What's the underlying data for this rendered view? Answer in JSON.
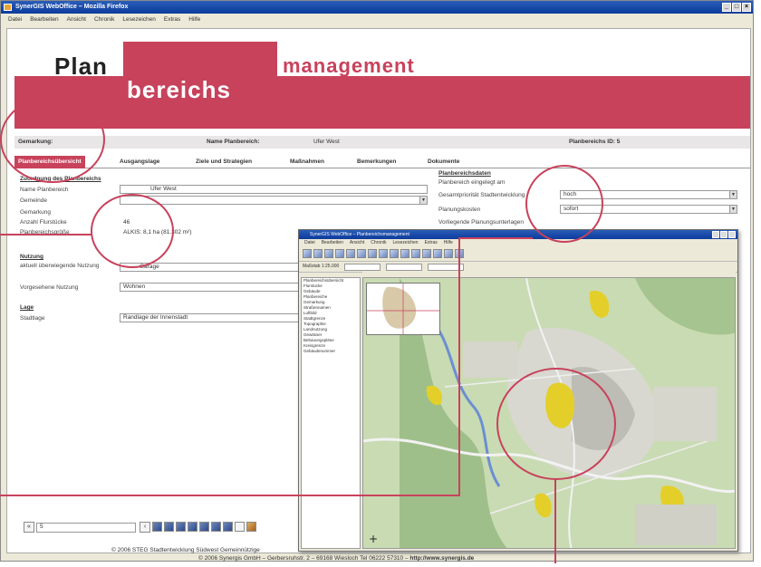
{
  "window": {
    "title": "SynerGIS WebOffice – Mozilla Firefox"
  },
  "menubar": [
    "Datei",
    "Bearbeiten",
    "Ansicht",
    "Chronik",
    "Lesezeichen",
    "Extras",
    "Hilfe"
  ],
  "banner": {
    "plan": "Plan",
    "bereichs": "bereichs",
    "management": "management"
  },
  "infobar": {
    "gemarkung_label": "Gemarkung:",
    "name_label": "Name Planbereich:",
    "name_value": "Ufer West",
    "id_label": "Planbereichs ID: 5"
  },
  "tabs": [
    {
      "label": "Planbereichsübersicht",
      "active": true
    },
    {
      "label": "Ausgangslage",
      "active": false
    },
    {
      "label": "Ziele und Strategien",
      "active": false
    },
    {
      "label": "Maßnahmen",
      "active": false
    },
    {
      "label": "Bemerkungen",
      "active": false
    },
    {
      "label": "Dokumente",
      "active": false
    }
  ],
  "zuordnung": {
    "title": "Zuordnung des Planbereichs",
    "name_label": "Name Planbereich",
    "name_value": "Ufer West",
    "gemeinde_label": "Gemeinde",
    "gemeinde_value": "",
    "gemarkung_label": "Gemarkung",
    "flurstuecke_label": "Anzahl Flurstücke",
    "flurstuecke_value": "46",
    "groesse_label": "Planbereichsgröße",
    "groesse_value": "ALKIS: 8,1 ha (81.302 m²)"
  },
  "nutzung": {
    "title": "Nutzung",
    "aktuell_label": "aktuell überwiegende Nutzung",
    "aktuell_value": "Garage",
    "vorgesehen_label": "Vorgesehene Nutzung",
    "vorgesehen_value": "Wohnen"
  },
  "lage": {
    "title": "Lage",
    "stadt_label": "Stadtlage",
    "stadt_value": "Randlage der Innenstadt"
  },
  "planbereichsdaten": {
    "title": "Planbereichsdaten",
    "eingelegt_label": "Planbereich eingelegt am",
    "prio_label": "Gesamtpriorität Stadtentwicklung",
    "prio_value": "hoch",
    "verfuegbar_label": "Planungskosten",
    "verfuegbar_value": "sofort",
    "vorliegend_label": "Vorliegende Planungsunterlagen"
  },
  "nav": {
    "page_field": "5"
  },
  "footer": {
    "line1": "© 2006 STEG Stadtentwicklung Südwest Gemeinnützige",
    "line2_prefix": "© 2006 Synergis GmbH – Gerbersruhstr. 2 – 69168 Wiesloch Tel 06222 57310 – ",
    "line2_url": "http://www.synergis.de"
  },
  "inset": {
    "title": "SynerGIS WebOffice – Planbereichsmanagement",
    "menu": [
      "Datei",
      "Bearbeiten",
      "Ansicht",
      "Chronik",
      "Lesezeichen",
      "Extras",
      "Hilfe"
    ],
    "layers": [
      "Planbereichsübersicht",
      "Flurstücke",
      "Gebäude",
      "Planbereiche",
      "Gemarkung",
      "Straßennamen",
      "Luftbild",
      "Stadtgrenze",
      "Topographie",
      "Landnutzung",
      "Gewässer",
      "Bebauungspläne",
      "Kreisgrenze",
      "Gebäudenummer"
    ],
    "scale_label": "Maßstab 1:25.000"
  }
}
